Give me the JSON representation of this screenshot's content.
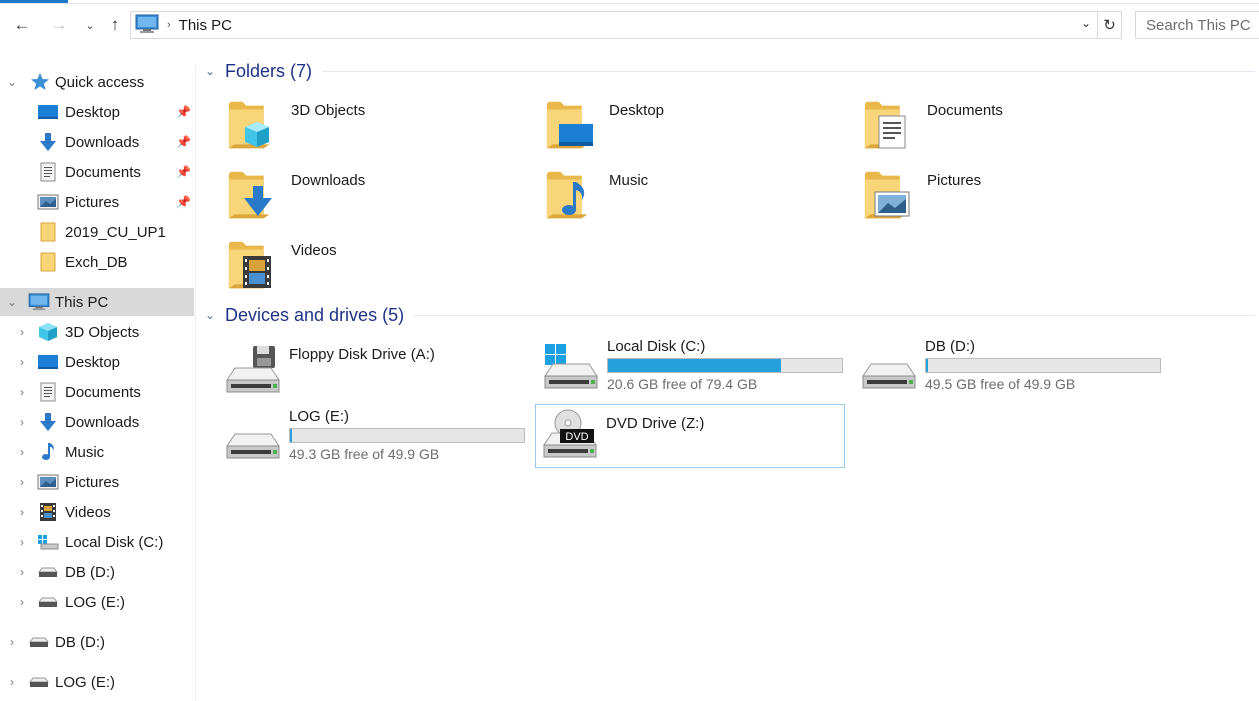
{
  "window": {
    "accent_color": "#1979ca"
  },
  "nav": {
    "back_icon": "arrow-left-icon",
    "forward_icon": "arrow-right-icon",
    "recent_icon": "chevron-down-icon",
    "up_icon": "arrow-up-icon",
    "breadcrumb": "This PC",
    "refresh_icon": "refresh-icon",
    "search_placeholder": "Search This PC"
  },
  "sidebar": {
    "quick_access": {
      "label": "Quick access",
      "items": [
        {
          "label": "Desktop",
          "icon": "desktop-icon",
          "pinned": true
        },
        {
          "label": "Downloads",
          "icon": "downloads-icon",
          "pinned": true
        },
        {
          "label": "Documents",
          "icon": "documents-icon",
          "pinned": true
        },
        {
          "label": "Pictures",
          "icon": "pictures-icon",
          "pinned": true
        },
        {
          "label": "2019_CU_UP1",
          "icon": "folder-icon",
          "pinned": false
        },
        {
          "label": "Exch_DB",
          "icon": "folder-icon",
          "pinned": false
        }
      ]
    },
    "this_pc": {
      "label": "This PC",
      "items": [
        {
          "label": "3D Objects",
          "icon": "3d-objects-icon"
        },
        {
          "label": "Desktop",
          "icon": "desktop-icon"
        },
        {
          "label": "Documents",
          "icon": "documents-icon"
        },
        {
          "label": "Downloads",
          "icon": "downloads-icon"
        },
        {
          "label": "Music",
          "icon": "music-icon"
        },
        {
          "label": "Pictures",
          "icon": "pictures-icon"
        },
        {
          "label": "Videos",
          "icon": "videos-icon"
        },
        {
          "label": "Local Disk (C:)",
          "icon": "windows-drive-icon"
        },
        {
          "label": "DB (D:)",
          "icon": "drive-icon"
        },
        {
          "label": "LOG (E:)",
          "icon": "drive-icon"
        }
      ]
    },
    "roots": [
      {
        "label": "DB (D:)",
        "icon": "drive-icon"
      },
      {
        "label": "LOG (E:)",
        "icon": "drive-icon"
      }
    ]
  },
  "folders": {
    "title": "Folders (7)",
    "items": [
      {
        "label": "3D Objects",
        "icon": "3d-objects-folder-icon"
      },
      {
        "label": "Desktop",
        "icon": "desktop-folder-icon"
      },
      {
        "label": "Documents",
        "icon": "documents-folder-icon"
      },
      {
        "label": "Downloads",
        "icon": "downloads-folder-icon"
      },
      {
        "label": "Music",
        "icon": "music-folder-icon"
      },
      {
        "label": "Pictures",
        "icon": "pictures-folder-icon"
      },
      {
        "label": "Videos",
        "icon": "videos-folder-icon"
      }
    ]
  },
  "drives": {
    "title": "Devices and drives (5)",
    "items": [
      {
        "label": "Floppy Disk Drive (A:)",
        "icon": "floppy-drive-icon",
        "free": "",
        "used_fraction": null
      },
      {
        "label": "Local Disk (C:)",
        "icon": "windows-drive-icon",
        "free": "20.6 GB free of 79.4 GB",
        "used_fraction": 0.74
      },
      {
        "label": "DB (D:)",
        "icon": "drive-icon",
        "free": "49.5 GB free of 49.9 GB",
        "used_fraction": 0.01
      },
      {
        "label": "LOG (E:)",
        "icon": "drive-icon",
        "free": "49.3 GB free of 49.9 GB",
        "used_fraction": 0.01
      },
      {
        "label": "DVD Drive (Z:)",
        "icon": "dvd-drive-icon",
        "free": "",
        "used_fraction": null,
        "badge": "DVD"
      }
    ],
    "bar_color": "#26a0da"
  }
}
